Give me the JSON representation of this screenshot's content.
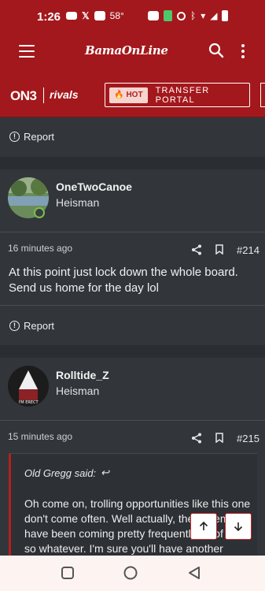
{
  "status_bar": {
    "time": "1:26",
    "temp": "58°",
    "icons": [
      "youtube-icon",
      "x-icon",
      "photo-icon",
      "temp-icon",
      "radio-icon",
      "battery-saver-icon",
      "alarm-icon",
      "bluetooth-icon",
      "wifi-icon",
      "signal-icon",
      "battery-icon"
    ]
  },
  "header": {
    "logo": "BamaOnLine",
    "icons": [
      "menu-icon",
      "search-icon",
      "more-icon"
    ]
  },
  "on3bar": {
    "on3": "ON3",
    "rivals": "rivals",
    "hot": "HOT",
    "hot_label": "TRANSFER PORTAL"
  },
  "posts": [
    {
      "report": "Report"
    },
    {
      "username": "OneTwoCanoe",
      "title": "Heisman",
      "time": "16 minutes ago",
      "number": "#214",
      "body": "At this point just lock down the whole board. Send us home for the day lol",
      "report": "Report"
    },
    {
      "username": "Rolltide_Z",
      "title": "Heisman",
      "time": "15 minutes ago",
      "number": "#215",
      "quote": {
        "author": "Old Gregg said:",
        "text": "Oh come on, trolling opportunities like this one don't come often. Well actually, they seem to have been coming pretty frequently as of late, so whatever. I'm sure you'll have another"
      }
    }
  ],
  "colors": {
    "brand": "#a3181c",
    "background": "#32363b"
  }
}
